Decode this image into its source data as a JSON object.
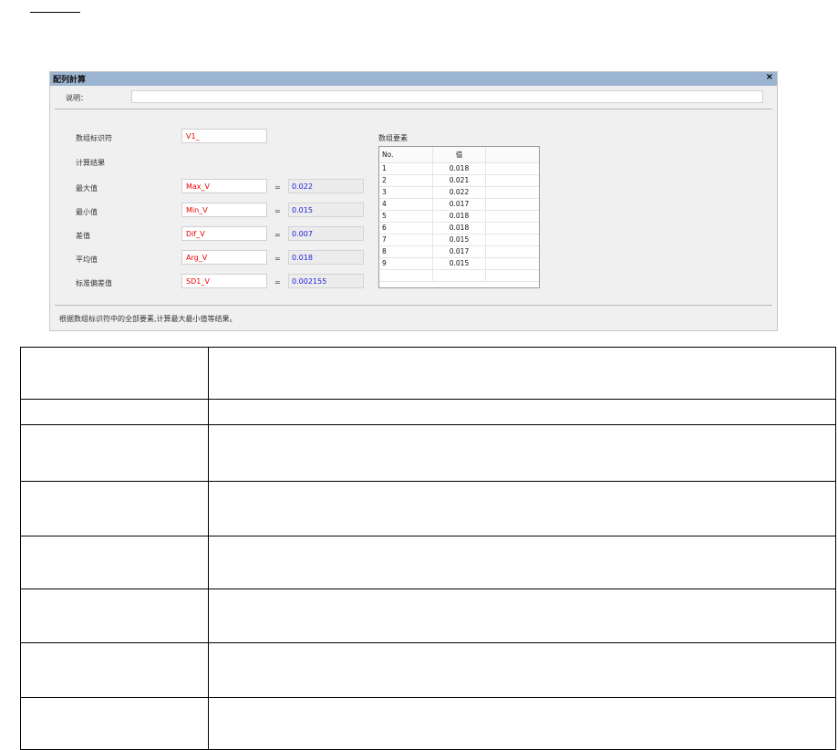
{
  "dialog": {
    "title": "配列計算",
    "close_label": "×",
    "description_label": "说明：",
    "description_value": "",
    "array_id_label": "数组标识符",
    "array_id_value": "V1_",
    "results_heading": "计算结果",
    "equals": "=",
    "results": [
      {
        "label": "最大值",
        "var": "Max_V",
        "value": "0.022"
      },
      {
        "label": "最小值",
        "var": "Min_V",
        "value": "0.015"
      },
      {
        "label": "差值",
        "var": "Dif_V",
        "value": "0.007"
      },
      {
        "label": "平均值",
        "var": "Arg_V",
        "value": "0.018"
      },
      {
        "label": "标准偏差值",
        "var": "SD1_V",
        "value": "0.002155"
      }
    ],
    "elements_label": "数组要素",
    "grid": {
      "headers": [
        "No.",
        "值"
      ],
      "rows": [
        [
          "1",
          "0.018"
        ],
        [
          "2",
          "0.021"
        ],
        [
          "3",
          "0.022"
        ],
        [
          "4",
          "0.017"
        ],
        [
          "5",
          "0.018"
        ],
        [
          "6",
          "0.018"
        ],
        [
          "7",
          "0.015"
        ],
        [
          "8",
          "0.017"
        ],
        [
          "9",
          "0.015"
        ]
      ]
    },
    "footer": "根据数组标识符中的全部要素,计算最大最小值等结果。"
  }
}
